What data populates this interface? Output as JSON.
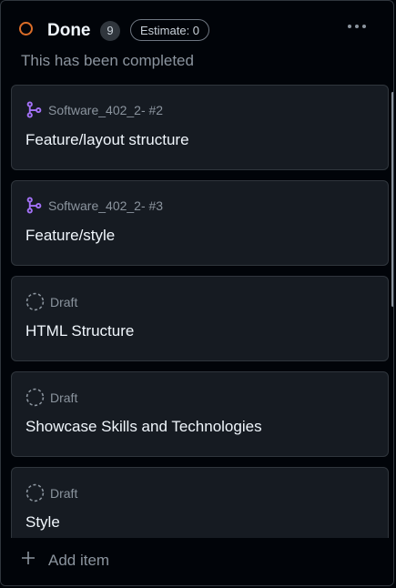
{
  "column": {
    "title": "Done",
    "count": "9",
    "estimate": "Estimate: 0",
    "description": "This has been completed",
    "status_color": "#db6d28"
  },
  "cards": [
    {
      "type": "pull-request",
      "icon": "git-pr-icon",
      "meta": "Software_402_2- #2",
      "title": "Feature/layout structure"
    },
    {
      "type": "pull-request",
      "icon": "git-pr-icon",
      "meta": "Software_402_2- #3",
      "title": "Feature/style"
    },
    {
      "type": "draft",
      "icon": "draft-icon",
      "meta": "Draft",
      "title": "HTML Structure"
    },
    {
      "type": "draft",
      "icon": "draft-icon",
      "meta": "Draft",
      "title": "Showcase Skills and Technologies"
    },
    {
      "type": "draft",
      "icon": "draft-icon",
      "meta": "Draft",
      "title": "Style"
    }
  ],
  "footer": {
    "add_label": "Add item"
  },
  "colors": {
    "pr_icon": "#a371f7",
    "draft_icon": "#8b949e"
  }
}
